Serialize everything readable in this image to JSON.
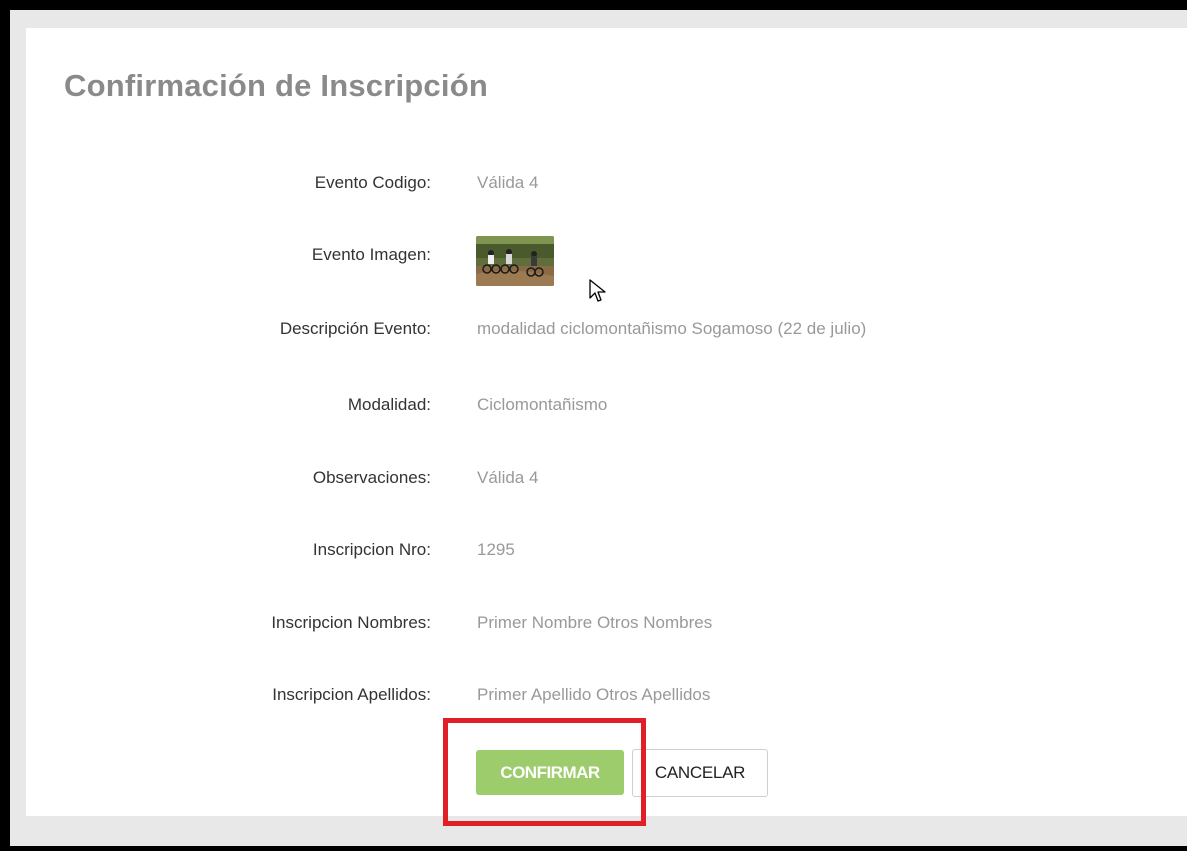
{
  "page": {
    "title": "Confirmación de Inscripción"
  },
  "fields": [
    {
      "label": "Evento Codigo:",
      "value": "Válida 4"
    },
    {
      "label": "Evento Imagen:",
      "value": ""
    },
    {
      "label": "Descripción Evento:",
      "value": "modalidad ciclomontañismo Sogamoso (22 de julio)"
    },
    {
      "label": "Modalidad:",
      "value": "Ciclomontañismo"
    },
    {
      "label": "Observaciones:",
      "value": "Válida 4"
    },
    {
      "label": "Inscripcion Nro:",
      "value": "1295"
    },
    {
      "label": "Inscripcion Nombres:",
      "value": "Primer Nombre Otros Nombres"
    },
    {
      "label": "Inscripcion Apellidos:",
      "value": "Primer Apellido Otros Apellidos"
    }
  ],
  "buttons": {
    "confirm_label": "CONFIRMAR",
    "cancel_label": "CANCELAR"
  },
  "colors": {
    "confirm_bg": "#9ccc6c",
    "highlight_border": "#e01f26",
    "title": "#8a8a8a",
    "value_text": "#999999"
  },
  "icons": [
    "mouse-pointer-icon"
  ]
}
